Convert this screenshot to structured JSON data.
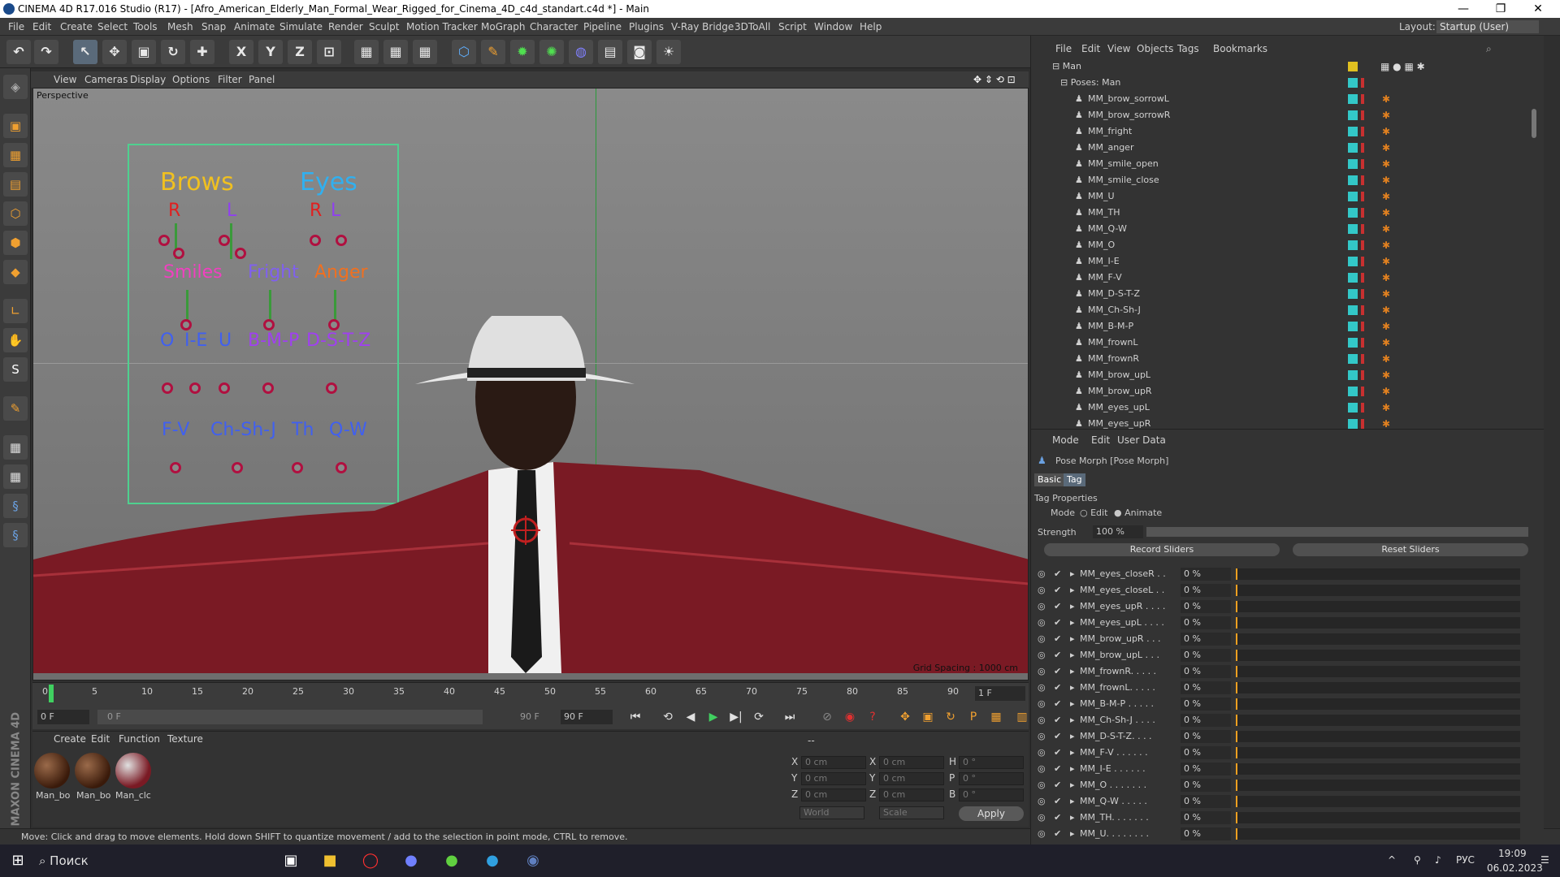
{
  "window": {
    "title": "CINEMA 4D R17.016 Studio (R17) - [Afro_American_Elderly_Man_Formal_Wear_Rigged_for_Cinema_4D_c4d_standart.c4d *] - Main",
    "minimize": "—",
    "maximize": "❐",
    "close": "✕"
  },
  "menu": [
    "File",
    "Edit",
    "Create",
    "Select",
    "Tools",
    "Mesh",
    "Snap",
    "Animate",
    "Simulate",
    "Render",
    "Sculpt",
    "Motion Tracker",
    "MoGraph",
    "Character",
    "Pipeline",
    "Plugins",
    "V-Ray Bridge",
    "3DToAll",
    "Script",
    "Window",
    "Help"
  ],
  "layout": {
    "label": "Layout:",
    "value": "Startup (User)"
  },
  "toolbar": {
    "undo": "↶",
    "redo": "↷",
    "select": "↖",
    "move": "✥",
    "scale": "▣",
    "rotate": "↻",
    "snap": "✚",
    "x": "X",
    "y": "Y",
    "z": "Z",
    "coord": "⊡",
    "render1": "▦",
    "render2": "▦",
    "render3": "▦",
    "cube": "⬡",
    "pen": "✎",
    "subdiv": "✹",
    "cloner": "✺",
    "deformer": "◍",
    "floor": "▤",
    "camera": "◙",
    "light": "☀"
  },
  "viewport": {
    "menu": [
      "View",
      "Cameras",
      "Display",
      "Options",
      "Filter",
      "Panel"
    ],
    "label": "Perspective",
    "grid_spacing": "Grid Spacing : 1000 cm",
    "nav": "✥ ⇕ ⟲ ⊡"
  },
  "facepanel": {
    "brows": "Brows",
    "eyes": "Eyes",
    "brows_r": "R",
    "brows_l": "L",
    "eyes_r": "R",
    "eyes_l": "L",
    "smiles": "Smiles",
    "fright": "Fright",
    "anger": "Anger",
    "o": "O",
    "ie": "I-E",
    "u": "U",
    "bmp": "B-M-P",
    "dstz": "D-S-T-Z",
    "fv": "F-V",
    "chshj": "Ch-Sh-J",
    "th": "Th",
    "qw": "Q-W"
  },
  "timeline": {
    "ticks": [
      "0",
      "5",
      "10",
      "15",
      "20",
      "25",
      "30",
      "35",
      "40",
      "45",
      "50",
      "55",
      "60",
      "65",
      "70",
      "75",
      "80",
      "85",
      "90"
    ],
    "frame_field": "1 F",
    "start": "0 F",
    "range_start": "0 F",
    "range_end": "90 F",
    "end": "90 F"
  },
  "playback": [
    "⏮",
    "⟲",
    "◀",
    "▶",
    "▶|",
    "⟳",
    "⏭"
  ],
  "materials": {
    "menu": [
      "Create",
      "Edit",
      "Function",
      "Texture"
    ],
    "items": [
      "Man_bo",
      "Man_bo",
      "Man_clc"
    ]
  },
  "coords": {
    "header": "--",
    "x_label": "X",
    "y_label": "Y",
    "z_label": "Z",
    "h_label": "H",
    "p_label": "P",
    "b_label": "B",
    "pos_x": "0 cm",
    "pos_y": "0 cm",
    "pos_z": "0 cm",
    "size_x": "0 cm",
    "size_y": "0 cm",
    "size_z": "0 cm",
    "rot_h": "0 °",
    "rot_p": "0 °",
    "rot_b": "0 °",
    "world": "World",
    "scale": "Scale",
    "apply": "Apply"
  },
  "status": "Move: Click and drag to move elements. Hold down SHIFT to quantize movement / add to the selection in point mode, CTRL to remove.",
  "maxon": "MAXON CINEMA 4D",
  "objects": {
    "menu": [
      "File",
      "Edit",
      "View",
      "Objects",
      "Tags",
      "Bookmarks"
    ],
    "root": "Man",
    "poses": "Poses: Man",
    "items": [
      "MM_brow_sorrowL",
      "MM_brow_sorrowR",
      "MM_fright",
      "MM_anger",
      "MM_smile_open",
      "MM_smile_close",
      "MM_U",
      "MM_TH",
      "MM_Q-W",
      "MM_O",
      "MM_I-E",
      "MM_F-V",
      "MM_D-S-T-Z",
      "MM_Ch-Sh-J",
      "MM_B-M-P",
      "MM_frownL",
      "MM_frownR",
      "MM_brow_upL",
      "MM_brow_upR",
      "MM_eyes_upL",
      "MM_eyes_upR"
    ]
  },
  "attributes": {
    "menu": [
      "Mode",
      "Edit",
      "User Data"
    ],
    "title": "Pose Morph [Pose Morph]",
    "tab_basic": "Basic",
    "tab_tag": "Tag",
    "section": "Tag Properties",
    "mode_label": "Mode",
    "mode_edit": "Edit",
    "mode_animate": "Animate",
    "strength_label": "Strength",
    "strength": "100 %",
    "record": "Record Sliders",
    "reset": "Reset Sliders",
    "sliders": [
      {
        "name": "MM_eyes_closeR . .",
        "value": "0 %"
      },
      {
        "name": "MM_eyes_closeL . .",
        "value": "0 %"
      },
      {
        "name": "MM_eyes_upR . . . .",
        "value": "0 %"
      },
      {
        "name": "MM_eyes_upL . . . .",
        "value": "0 %"
      },
      {
        "name": "MM_brow_upR . . .",
        "value": "0 %"
      },
      {
        "name": "MM_brow_upL . . .",
        "value": "0 %"
      },
      {
        "name": "MM_frownR. . . . .",
        "value": "0 %"
      },
      {
        "name": "MM_frownL. . . . .",
        "value": "0 %"
      },
      {
        "name": "MM_B-M-P . . . . .",
        "value": "0 %"
      },
      {
        "name": "MM_Ch-Sh-J . . . .",
        "value": "0 %"
      },
      {
        "name": "MM_D-S-T-Z. . . .",
        "value": "0 %"
      },
      {
        "name": "MM_F-V . . . . . .",
        "value": "0 %"
      },
      {
        "name": "MM_I-E . . . . . .",
        "value": "0 %"
      },
      {
        "name": "MM_O . . . . . . .",
        "value": "0 %"
      },
      {
        "name": "MM_Q-W . . . . .",
        "value": "0 %"
      },
      {
        "name": "MM_TH. . . . . . .",
        "value": "0 %"
      },
      {
        "name": "MM_U. . . . . . . .",
        "value": "0 %"
      }
    ]
  },
  "taskbar": {
    "start": "⊞",
    "search": "Поиск",
    "lang": "РУС",
    "time": "19:09",
    "date": "06.02.2023"
  },
  "colors": {
    "accent": "#33c8c8",
    "panel_border": "#4fd08f",
    "slider_knob": "#b01040",
    "brows": "#f0c020",
    "eyes": "#30b0f0",
    "smiles": "#f040c0",
    "fright": "#8060f0",
    "anger": "#f07020",
    "vowels": "#4060f0",
    "lips": "#a040f0"
  }
}
